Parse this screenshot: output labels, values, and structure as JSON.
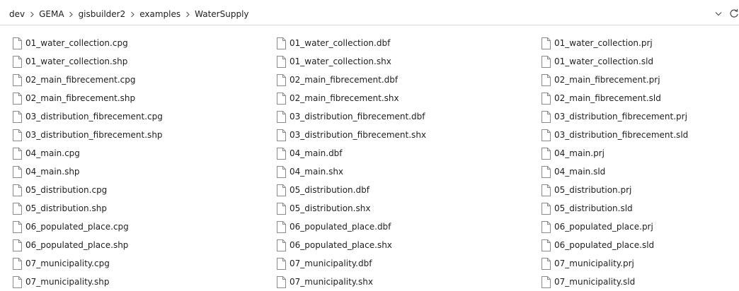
{
  "breadcrumb": [
    "dev",
    "GEMA",
    "gisbuilder2",
    "examples",
    "WaterSupply"
  ],
  "icons": {
    "separator": "chevron-right-icon",
    "dropdown": "chevron-down-icon",
    "refresh": "refresh-icon",
    "file": "file-icon"
  },
  "files": {
    "col1": [
      "01_water_collection.cpg",
      "01_water_collection.shp",
      "02_main_fibrecement.cpg",
      "02_main_fibrecement.shp",
      "03_distribution_fibrecement.cpg",
      "03_distribution_fibrecement.shp",
      "04_main.cpg",
      "04_main.shp",
      "05_distribution.cpg",
      "05_distribution.shp",
      "06_populated_place.cpg",
      "06_populated_place.shp",
      "07_municipality.cpg",
      "07_municipality.shp"
    ],
    "col2": [
      "01_water_collection.dbf",
      "01_water_collection.shx",
      "02_main_fibrecement.dbf",
      "02_main_fibrecement.shx",
      "03_distribution_fibrecement.dbf",
      "03_distribution_fibrecement.shx",
      "04_main.dbf",
      "04_main.shx",
      "05_distribution.dbf",
      "05_distribution.shx",
      "06_populated_place.dbf",
      "06_populated_place.shx",
      "07_municipality.dbf",
      "07_municipality.shx"
    ],
    "col3": [
      "01_water_collection.prj",
      "01_water_collection.sld",
      "02_main_fibrecement.prj",
      "02_main_fibrecement.sld",
      "03_distribution_fibrecement.prj",
      "03_distribution_fibrecement.sld",
      "04_main.prj",
      "04_main.sld",
      "05_distribution.prj",
      "05_distribution.sld",
      "06_populated_place.prj",
      "06_populated_place.sld",
      "07_municipality.prj",
      "07_municipality.sld"
    ]
  }
}
